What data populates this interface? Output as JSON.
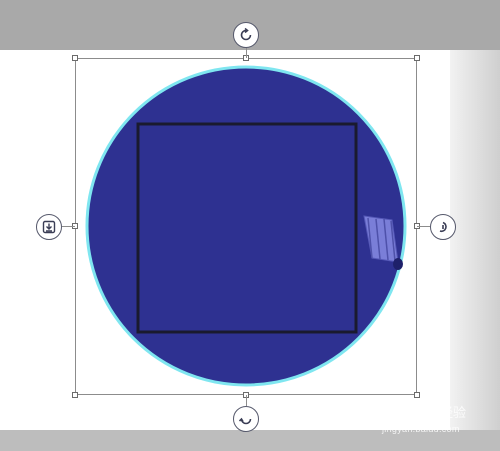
{
  "colors": {
    "shape_fill": "#2e3191",
    "shape_outline": "#7fe6f0",
    "square_stroke": "#1a1a2e",
    "background": "#a9a9a9",
    "canvas": "#ffffff"
  },
  "icons": {
    "rotate_top": "rotate-icon",
    "rotate_bottom": "flip-rotate-icon",
    "left": "download-icon",
    "right": "undo-rotate-icon"
  },
  "watermark": {
    "logo": "Bai",
    "suffix": "经验",
    "url": "jingyan.baidu.com"
  }
}
